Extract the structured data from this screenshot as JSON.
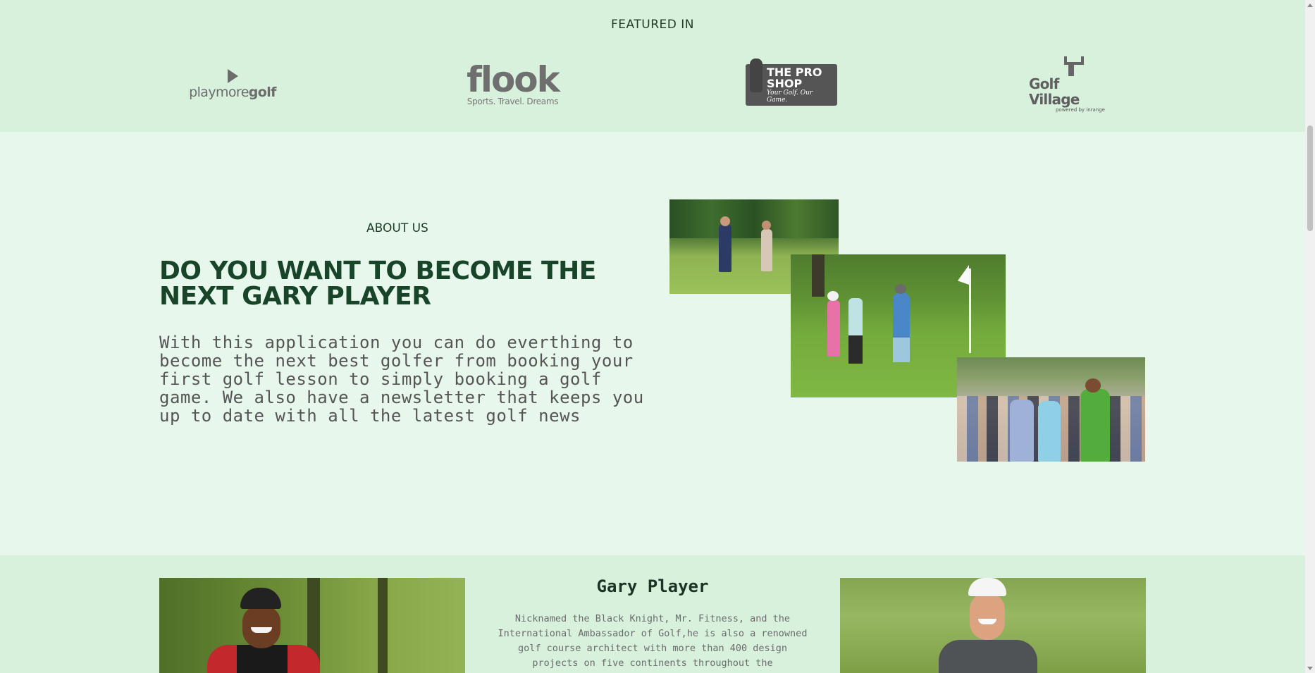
{
  "featured": {
    "title": "FEATURED IN",
    "logos": {
      "playmore_a": "playmore",
      "playmore_b": "golf",
      "flook_word": "flook",
      "flook_sub": "Sports. Travel. Dreams",
      "proshop_main": "THE PRO SHOP",
      "proshop_sub": "Your Golf. Our Game.",
      "golfvillage_main": "Golf Village",
      "golfvillage_sub": "powered by inrange"
    }
  },
  "about": {
    "label": "ABOUT US",
    "heading": "DO YOU WANT TO BECOME THE NEXT GARY PLAYER",
    "body": "With this application you can do everthing to become the next best golfer from booking your first golf lesson to simply booking a golf game. We also have a newsletter that keeps you up to date with all the latest golf news"
  },
  "player": {
    "name": "Gary Player",
    "bio": "Nicknamed the Black Knight, Mr. Fitness, and the International Ambassador of Golf,he is also a renowned golf course architect with more than 400 design projects on five continents throughout the"
  },
  "colors": {
    "featured_bg": "#d8f1dd",
    "about_bg": "#e8f7ec",
    "heading": "#18452a",
    "body_text": "#555555"
  }
}
